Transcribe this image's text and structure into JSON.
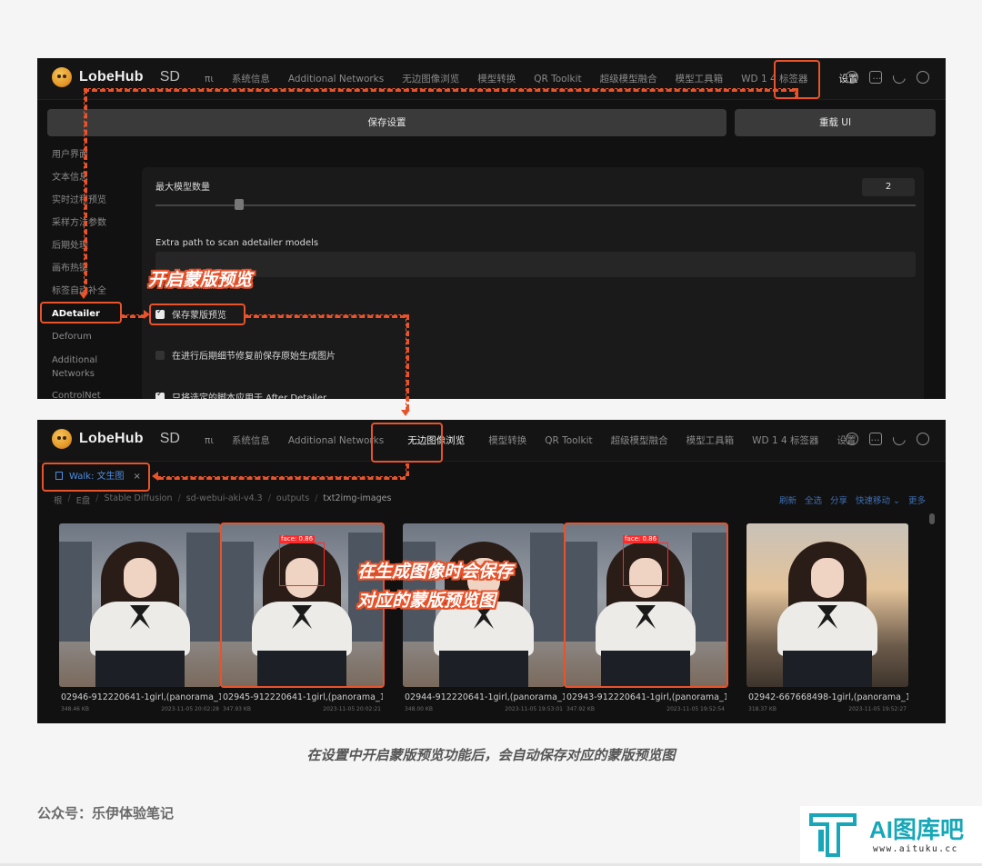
{
  "app": {
    "name": "LobeHub",
    "subtitle": "SD"
  },
  "nav": {
    "tabs": [
      "πι",
      "系统信息",
      "Additional Networks",
      "无边图像浏览",
      "模型转换",
      "QR Toolkit",
      "超级模型融合",
      "模型工具箱",
      "WD 1 4 标签器",
      "设置",
      "···"
    ]
  },
  "settings": {
    "save_label": "保存设置",
    "reload_label": "重载 UI",
    "sidebar_items": [
      "用户界面",
      "文本信息",
      "实时过程预览",
      "采样方法参数",
      "后期处理",
      "画布热键",
      "标签自动补全",
      "ADetailer",
      "Deforum",
      "Additional Networks",
      "ControlNet"
    ],
    "max_models_label": "最大模型数量",
    "max_models_value": "2",
    "max_models_slider_fraction": 0.11,
    "extra_path_label": "Extra path to scan adetailer models",
    "opt_save_mask": "保存蒙版预览",
    "opt_save_original": "在进行后期细节修复前保存原始生成图片",
    "opt_only_scripts": "只将选定的脚本应用于 After Detailer"
  },
  "browser": {
    "walk_tab": "Walk: 文生图",
    "breadcrumbs": [
      "根",
      "E盘",
      "Stable Diffusion",
      "sd-webui-aki-v4.3",
      "outputs",
      "txt2img-images"
    ],
    "actions": [
      "刷新",
      "全选",
      "分享",
      "快速移动 ⌄",
      "更多"
    ],
    "images": [
      {
        "name": "02946-912220641-1girl,(panorama_1...",
        "size": "348.46 KB",
        "date": "2023-11-05 20:02:28",
        "mask": false
      },
      {
        "name": "02945-912220641-1girl,(panorama_1...",
        "size": "347.93 KB",
        "date": "2023-11-05 20:02:21",
        "mask": true
      },
      {
        "name": "02944-912220641-1girl,(panorama_1...",
        "size": "348.00 KB",
        "date": "2023-11-05 19:53:01",
        "mask": false
      },
      {
        "name": "02943-912220641-1girl,(panorama_1...",
        "size": "347.92 KB",
        "date": "2023-11-05 19:52:54",
        "mask": true
      },
      {
        "name": "02942-667668498-1girl,(panorama_1...",
        "size": "318.37 KB",
        "date": "2023-11-05 19:52:27",
        "mask": false
      }
    ],
    "face_label": "face: 0.86"
  },
  "annotations": {
    "enable_mask": "开启蒙版预览",
    "save_line1": "在生成图像时会保存",
    "save_line2": "对应的蒙版预览图",
    "accent": "#e8532b"
  },
  "caption": "在设置中开启蒙版预览功能后，会自动保存对应的蒙版预览图",
  "source": "公众号：乐伊体验笔记",
  "watermark": {
    "title": "AI图库吧",
    "url": "www.aituku.cc"
  }
}
